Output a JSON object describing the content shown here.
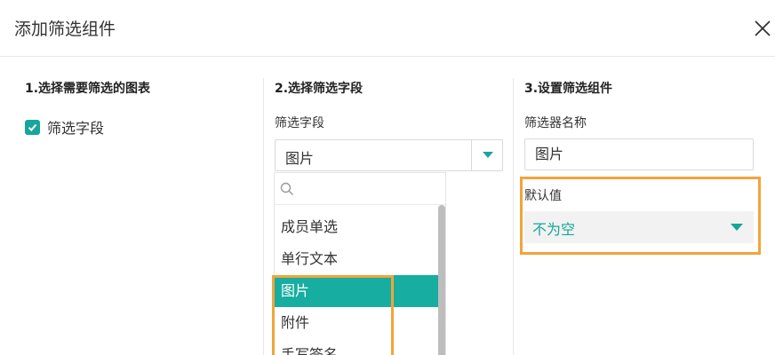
{
  "header": {
    "title": "添加筛选组件",
    "close_icon": "close-icon"
  },
  "step1": {
    "title": "1.选择需要筛选的图表",
    "checkbox_label": "筛选字段",
    "checked": true
  },
  "step2": {
    "title": "2.选择筛选字段",
    "field_label": "筛选字段",
    "selected_value": "图片",
    "search_placeholder": "",
    "options": [
      "成员单选",
      "单行文本",
      "图片",
      "附件",
      "手写签名"
    ],
    "selected_option": "图片"
  },
  "step3": {
    "title": "3.设置筛选组件",
    "name_label": "筛选器名称",
    "name_value": "图片",
    "default_label": "默认值",
    "default_value": "不为空"
  },
  "colors": {
    "accent": "#17a69a",
    "selected_bg": "#17ada0",
    "highlight": "#f2a43a"
  }
}
